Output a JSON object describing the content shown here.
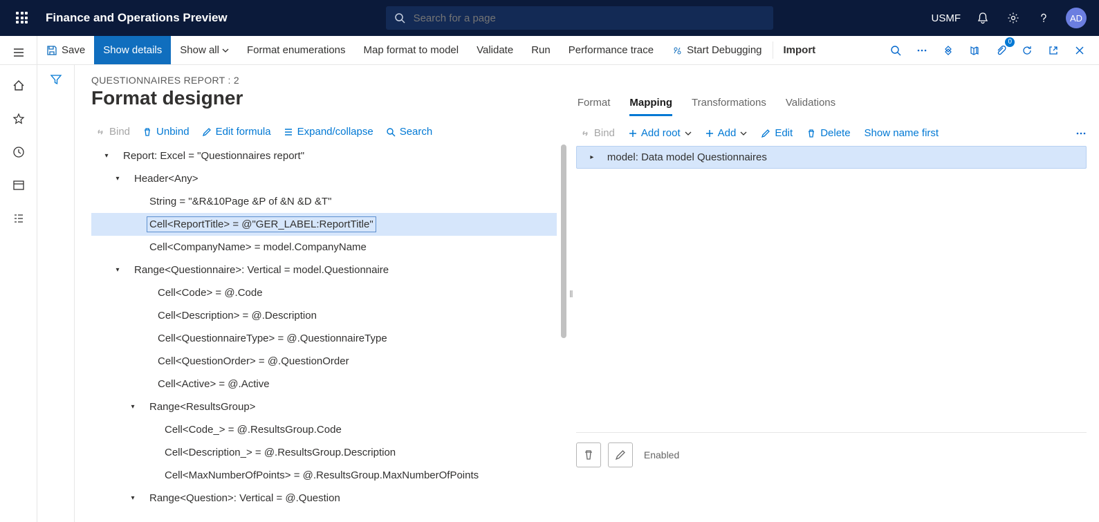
{
  "header": {
    "app_name": "Finance and Operations Preview",
    "search_placeholder": "Search for a page",
    "company": "USMF",
    "avatar_initials": "AD"
  },
  "actionbar": {
    "save": "Save",
    "show_details": "Show details",
    "show_all": "Show all",
    "format_enum": "Format enumerations",
    "map_format": "Map format to model",
    "validate": "Validate",
    "run": "Run",
    "perf_trace": "Performance trace",
    "start_debug": "Start Debugging",
    "import": "Import",
    "badge": "0"
  },
  "page": {
    "breadcrumb": "QUESTIONNAIRES REPORT : 2",
    "title": "Format designer"
  },
  "left_toolbar": {
    "bind": "Bind",
    "unbind": "Unbind",
    "edit_formula": "Edit formula",
    "expand_collapse": "Expand/collapse",
    "search": "Search"
  },
  "tree": [
    {
      "indent": 0,
      "caret": "expanded",
      "label": "Report: Excel = \"Questionnaires report\"",
      "selected": false
    },
    {
      "indent": 1,
      "caret": "expanded",
      "label": "Header<Any>",
      "selected": false
    },
    {
      "indent": 2,
      "caret": "none",
      "label": "String = \"&R&10Page &P of &N &D &T\"",
      "selected": false
    },
    {
      "indent": 2,
      "caret": "none",
      "label": "Cell<ReportTitle> = @\"GER_LABEL:ReportTitle\"",
      "selected": true
    },
    {
      "indent": 2,
      "caret": "none",
      "label": "Cell<CompanyName> = model.CompanyName",
      "selected": false
    },
    {
      "indent": 1,
      "caret": "expanded",
      "label": "Range<Questionnaire>: Vertical = model.Questionnaire",
      "selected": false
    },
    {
      "indent": 3,
      "caret": "none",
      "label": "Cell<Code> = @.Code",
      "selected": false
    },
    {
      "indent": 3,
      "caret": "none",
      "label": "Cell<Description> = @.Description",
      "selected": false
    },
    {
      "indent": 3,
      "caret": "none",
      "label": "Cell<QuestionnaireType> = @.QuestionnaireType",
      "selected": false
    },
    {
      "indent": 3,
      "caret": "none",
      "label": "Cell<QuestionOrder> = @.QuestionOrder",
      "selected": false
    },
    {
      "indent": 3,
      "caret": "none",
      "label": "Cell<Active> = @.Active",
      "selected": false
    },
    {
      "indent": 2,
      "caret": "expanded",
      "label": "Range<ResultsGroup>",
      "selected": false
    },
    {
      "indent": 4,
      "caret": "none",
      "label": "Cell<Code_> = @.ResultsGroup.Code",
      "selected": false
    },
    {
      "indent": 4,
      "caret": "none",
      "label": "Cell<Description_> = @.ResultsGroup.Description",
      "selected": false
    },
    {
      "indent": 4,
      "caret": "none",
      "label": "Cell<MaxNumberOfPoints> = @.ResultsGroup.MaxNumberOfPoints",
      "selected": false
    },
    {
      "indent": 2,
      "caret": "expanded",
      "label": "Range<Question>: Vertical = @.Question",
      "selected": false
    }
  ],
  "right": {
    "tabs": {
      "format": "Format",
      "mapping": "Mapping",
      "transformations": "Transformations",
      "validations": "Validations",
      "active": "mapping"
    },
    "toolbar": {
      "bind": "Bind",
      "add_root": "Add root",
      "add": "Add",
      "edit": "Edit",
      "delete": "Delete",
      "show_name": "Show name first"
    },
    "treeroot": "model: Data model Questionnaires",
    "enabled_label": "Enabled"
  }
}
